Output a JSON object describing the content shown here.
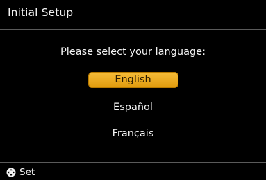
{
  "header": {
    "title": "Initial Setup"
  },
  "main": {
    "prompt": "Please select your language:",
    "languages": [
      {
        "label": "English",
        "selected": true
      },
      {
        "label": "Español",
        "selected": false
      },
      {
        "label": "Français",
        "selected": false
      }
    ]
  },
  "footer": {
    "icon": "dpad-icon",
    "set_label": "Set"
  },
  "colors": {
    "background": "#000000",
    "text": "#f4f4f4",
    "selection": "#f0a91f",
    "rule": "#5a5a5a"
  }
}
